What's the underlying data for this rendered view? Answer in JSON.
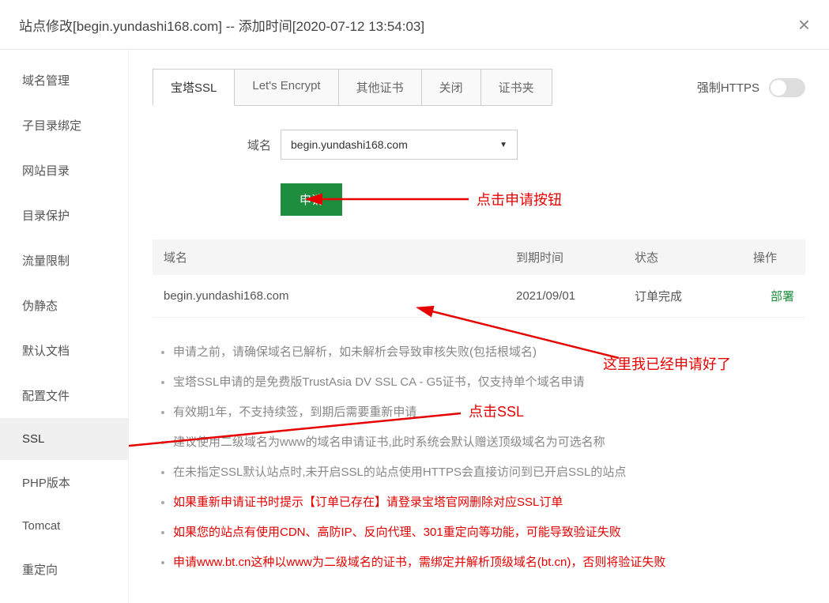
{
  "header": {
    "title": "站点修改[begin.yundashi168.com] -- 添加时间[2020-07-12 13:54:03]"
  },
  "sidebar": {
    "items": [
      {
        "label": "域名管理"
      },
      {
        "label": "子目录绑定"
      },
      {
        "label": "网站目录"
      },
      {
        "label": "目录保护"
      },
      {
        "label": "流量限制"
      },
      {
        "label": "伪静态"
      },
      {
        "label": "默认文档"
      },
      {
        "label": "配置文件"
      },
      {
        "label": "SSL",
        "active": true
      },
      {
        "label": "PHP版本"
      },
      {
        "label": "Tomcat"
      },
      {
        "label": "重定向"
      }
    ]
  },
  "tabs": [
    {
      "label": "宝塔SSL",
      "active": true
    },
    {
      "label": "Let's Encrypt"
    },
    {
      "label": "其他证书"
    },
    {
      "label": "关闭"
    },
    {
      "label": "证书夹"
    }
  ],
  "force_https_label": "强制HTTPS",
  "form": {
    "domain_label": "域名",
    "domain_value": "begin.yundashi168.com",
    "apply_button": "申请"
  },
  "table": {
    "headers": {
      "domain": "域名",
      "expire": "到期时间",
      "status": "状态",
      "op": "操作"
    },
    "rows": [
      {
        "domain": "begin.yundashi168.com",
        "expire": "2021/09/01",
        "status": "订单完成",
        "op": "部署"
      }
    ]
  },
  "notes": [
    {
      "text": "申请之前，请确保域名已解析，如未解析会导致审核失败(包括根域名)",
      "red": false
    },
    {
      "text": "宝塔SSL申请的是免费版TrustAsia DV SSL CA - G5证书，仅支持单个域名申请",
      "red": false
    },
    {
      "text": "有效期1年，不支持续签，到期后需要重新申请",
      "red": false
    },
    {
      "text": "建议使用二级域名为www的域名申请证书,此时系统会默认赠送顶级域名为可选名称",
      "red": false
    },
    {
      "text": "在未指定SSL默认站点时,未开启SSL的站点使用HTTPS会直接访问到已开启SSL的站点",
      "red": false
    },
    {
      "text": "如果重新申请证书时提示【订单已存在】请登录宝塔官网删除对应SSL订单",
      "red": true
    },
    {
      "text": "如果您的站点有使用CDN、高防IP、反向代理、301重定向等功能，可能导致验证失败",
      "red": true
    },
    {
      "text": "申请www.bt.cn这种以www为二级域名的证书，需绑定并解析顶级域名(bt.cn)，否则将验证失败",
      "red": true
    }
  ],
  "annotations": {
    "a1": "点击申请按钮",
    "a2": "这里我已经申请好了",
    "a3": "点击SSL"
  }
}
